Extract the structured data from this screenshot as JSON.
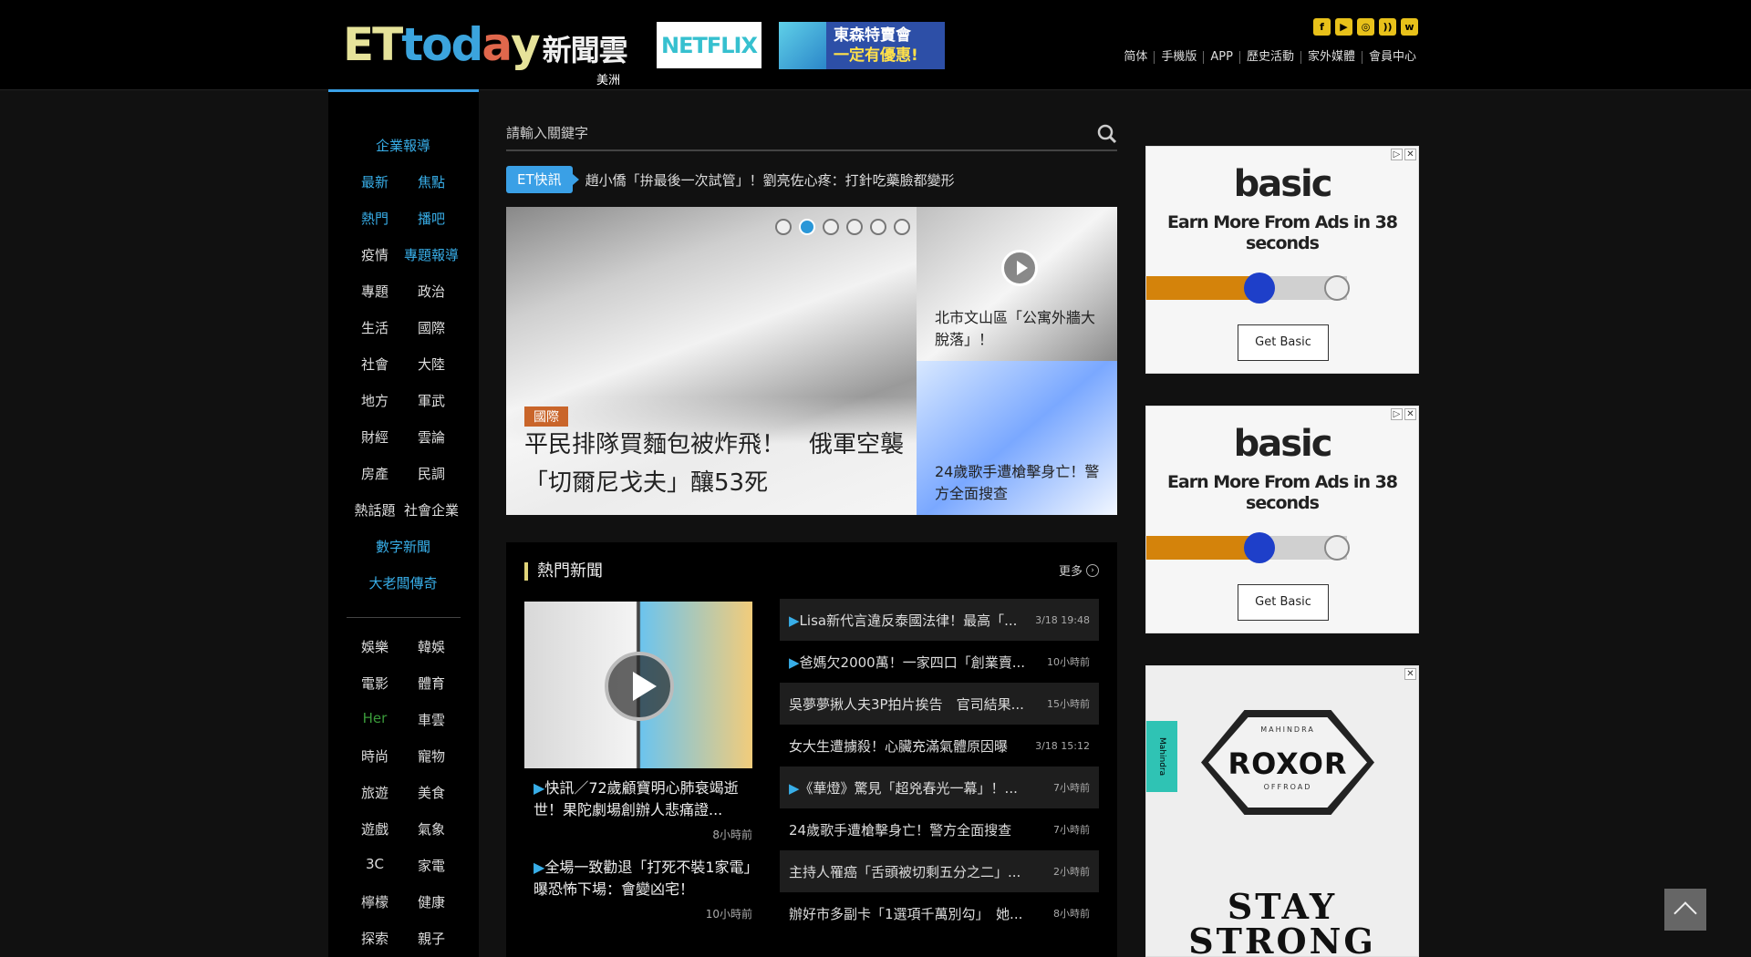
{
  "header": {
    "logo_letters": [
      {
        "ch": "E",
        "color": "#e6e39a"
      },
      {
        "ch": "T",
        "color": "#e6e39a"
      },
      {
        "ch": "t",
        "color": "#3ba4dd"
      },
      {
        "ch": "o",
        "color": "#3ba4dd"
      },
      {
        "ch": "d",
        "color": "#3ba4dd"
      },
      {
        "ch": "a",
        "color": "#e0674c"
      },
      {
        "ch": "y",
        "color": "#e6e39a"
      }
    ],
    "logo_zh": "新聞雲",
    "region": "美洲",
    "netflix_label": "NETFLIX",
    "promo_line1": "東森特賣會",
    "promo_line2": "一定有優惠!",
    "social_icons": [
      "facebook-icon",
      "youtube-icon",
      "instagram-icon",
      "rss-icon",
      "weibo-icon"
    ],
    "links": [
      "简体",
      "手機版",
      "APP",
      "歷史活動",
      "家外媒體",
      "會員中心"
    ]
  },
  "leftnav": {
    "top_items": [
      "企業報導"
    ],
    "pairs": [
      [
        "最新",
        "焦點"
      ],
      [
        "熱門",
        "播吧"
      ],
      [
        "疫情",
        "專題報導"
      ],
      [
        "專題",
        "政治"
      ],
      [
        "生活",
        "國際"
      ],
      [
        "社會",
        "大陸"
      ],
      [
        "地方",
        "軍武"
      ],
      [
        "財經",
        "雲論"
      ],
      [
        "房產",
        "民調"
      ],
      [
        "熱話題",
        "社會企業"
      ]
    ],
    "singles": [
      "數字新聞",
      "大老闆傳奇"
    ],
    "pairs2": [
      [
        "娛樂",
        "韓娛"
      ],
      [
        "電影",
        "體育"
      ],
      [
        "Her",
        "車雲"
      ],
      [
        "時尚",
        "寵物"
      ],
      [
        "旅遊",
        "美食"
      ],
      [
        "遊戲",
        "氣象"
      ],
      [
        "3C",
        "家電"
      ],
      [
        "檸檬",
        "健康"
      ],
      [
        "探索",
        "親子"
      ]
    ]
  },
  "search": {
    "placeholder": "請輸入關鍵字"
  },
  "flash": {
    "tag": "ET快訊",
    "text": "趙小僑「拚最後一次試管」！劉亮佐心疼：打針吃藥臉都變形"
  },
  "hero": {
    "category": "國際",
    "title": "平民排隊買麵包被炸飛！　俄軍空襲「切爾尼戈夫」釀53死",
    "side1": "北市文山區「公寓外牆大脫落」！",
    "side2": "24歲歌手遭槍擊身亡！警方全面搜查",
    "active_slide": 2,
    "slides": 6
  },
  "hot": {
    "title": "熱門新聞",
    "more": "更多",
    "story1": {
      "title": "快訊／72歲顧寶明心肺衰竭逝世！果陀劇場創辦人悲痛證...",
      "time": "8小時前"
    },
    "story2": {
      "title": "全場一致勸退「打死不裝1家電」　曝恐怖下場：會變凶宅！",
      "time": "10小時前"
    },
    "list": [
      {
        "title": "Lisa新代言違反泰國法律！最高「...",
        "time": "3/18 19:48",
        "video": true
      },
      {
        "title": "爸媽欠2000萬！一家四口「創業賣...",
        "time": "10小時前",
        "video": true
      },
      {
        "title": "吳夢夢揪人夫3P拍片挨告　官司結果...",
        "time": "15小時前",
        "video": false
      },
      {
        "title": "女大生遭擄殺！心臟充滿氣體原因曝",
        "time": "3/18 15:12",
        "video": false
      },
      {
        "title": "《華燈》驚見「超兇春光一幕」！...",
        "time": "7小時前",
        "video": true
      },
      {
        "title": "24歲歌手遭槍擊身亡！警方全面搜查",
        "time": "7小時前",
        "video": false
      },
      {
        "title": "主持人罹癌「舌頭被切剩五分之二」...",
        "time": "2小時前",
        "video": false
      },
      {
        "title": "辦好市多副卡「1選項千萬別勾」　她...",
        "time": "8小時前",
        "video": false
      }
    ]
  },
  "ads": {
    "basic_brand": "basic",
    "basic_headline": "Earn More From Ads in 38 seconds",
    "basic_button": "Get Basic",
    "basic_progress": 0.55,
    "roxor_brand": "ROXOR",
    "roxor_top": "MAHINDRA",
    "roxor_bottom": "OFFROAD",
    "roxor_side": "Mahindra",
    "roxor_slogan": "STAY STRONG"
  }
}
